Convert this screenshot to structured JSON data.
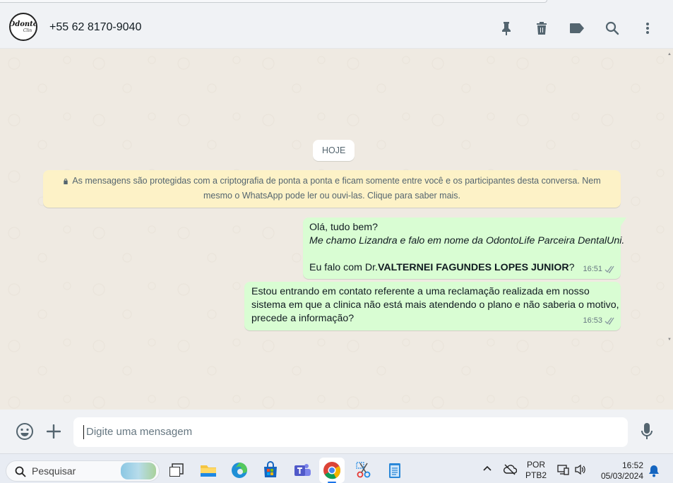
{
  "contact": {
    "name": "+55 62 8170-9040",
    "avatar_logo_main": "Odonto",
    "avatar_logo_sub": "Clin"
  },
  "header_icons": [
    "pin-icon",
    "trash-icon",
    "label-icon",
    "search-icon",
    "menu-icon"
  ],
  "chat": {
    "date_chip": "HOJE",
    "encryption_notice_line1": "As mensagens são protegidas com a criptografia de ponta a ponta e ficam somente entre você e os participantes desta conversa. Nem",
    "encryption_notice_line2": "mesmo o WhatsApp pode ler ou ouvi-las. Clique para saber mais.",
    "messages": [
      {
        "line1": "Olá, tudo bem?",
        "line2": "Me chamo Lizandra e falo em nome da OdontoLife Parceira DentalUni.",
        "line4_prefix": "Eu falo com Dr.",
        "line4_bold": "VALTERNEI FAGUNDES LOPES JUNIOR",
        "line4_suffix": "?",
        "time": "16:51"
      },
      {
        "line1": "Estou entrando em contato referente a uma reclamação realizada em nosso",
        "line2": "sistema em que a clinica não está mais atendendo o plano e não saberia o motivo,",
        "line3": "precede a informação?",
        "time": "16:53"
      }
    ]
  },
  "composer": {
    "placeholder": "Digite uma mensagem"
  },
  "taskbar": {
    "search_label": "Pesquisar",
    "language_line1": "POR",
    "language_line2": "PTB2",
    "time": "16:52",
    "date": "05/03/2024"
  },
  "colors": {
    "chat_bg": "#efeae2",
    "outgoing_bubble": "#d9fdd3",
    "notice_bg": "#fdf2c7",
    "tick": "#8696a0"
  }
}
